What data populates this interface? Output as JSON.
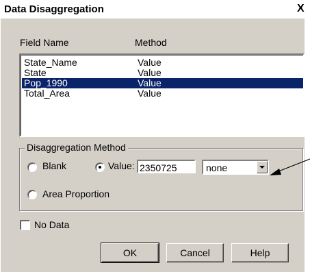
{
  "window": {
    "title": "Data Disaggregation",
    "close_glyph": "X"
  },
  "list": {
    "headers": [
      "Field Name",
      "Method"
    ],
    "rows": [
      {
        "field": "State_Name",
        "method": "Value"
      },
      {
        "field": "State",
        "method": "Value"
      },
      {
        "field": "Pop_1990",
        "method": "Value",
        "selected": true
      },
      {
        "field": "Total_Area",
        "method": "Value"
      }
    ]
  },
  "group": {
    "title": "Disaggregation Method",
    "blank_label": "Blank",
    "value_label": "Value:",
    "value": "2350725",
    "dropdown_selected": "none",
    "area_label": "Area Proportion",
    "selected_option": "Value"
  },
  "no_data": {
    "label": "No Data",
    "checked": false
  },
  "buttons": {
    "ok": "OK",
    "cancel": "Cancel",
    "help": "Help"
  },
  "colors": {
    "dialog_bg": "#d4d0c8",
    "selection": "#0a246a"
  }
}
